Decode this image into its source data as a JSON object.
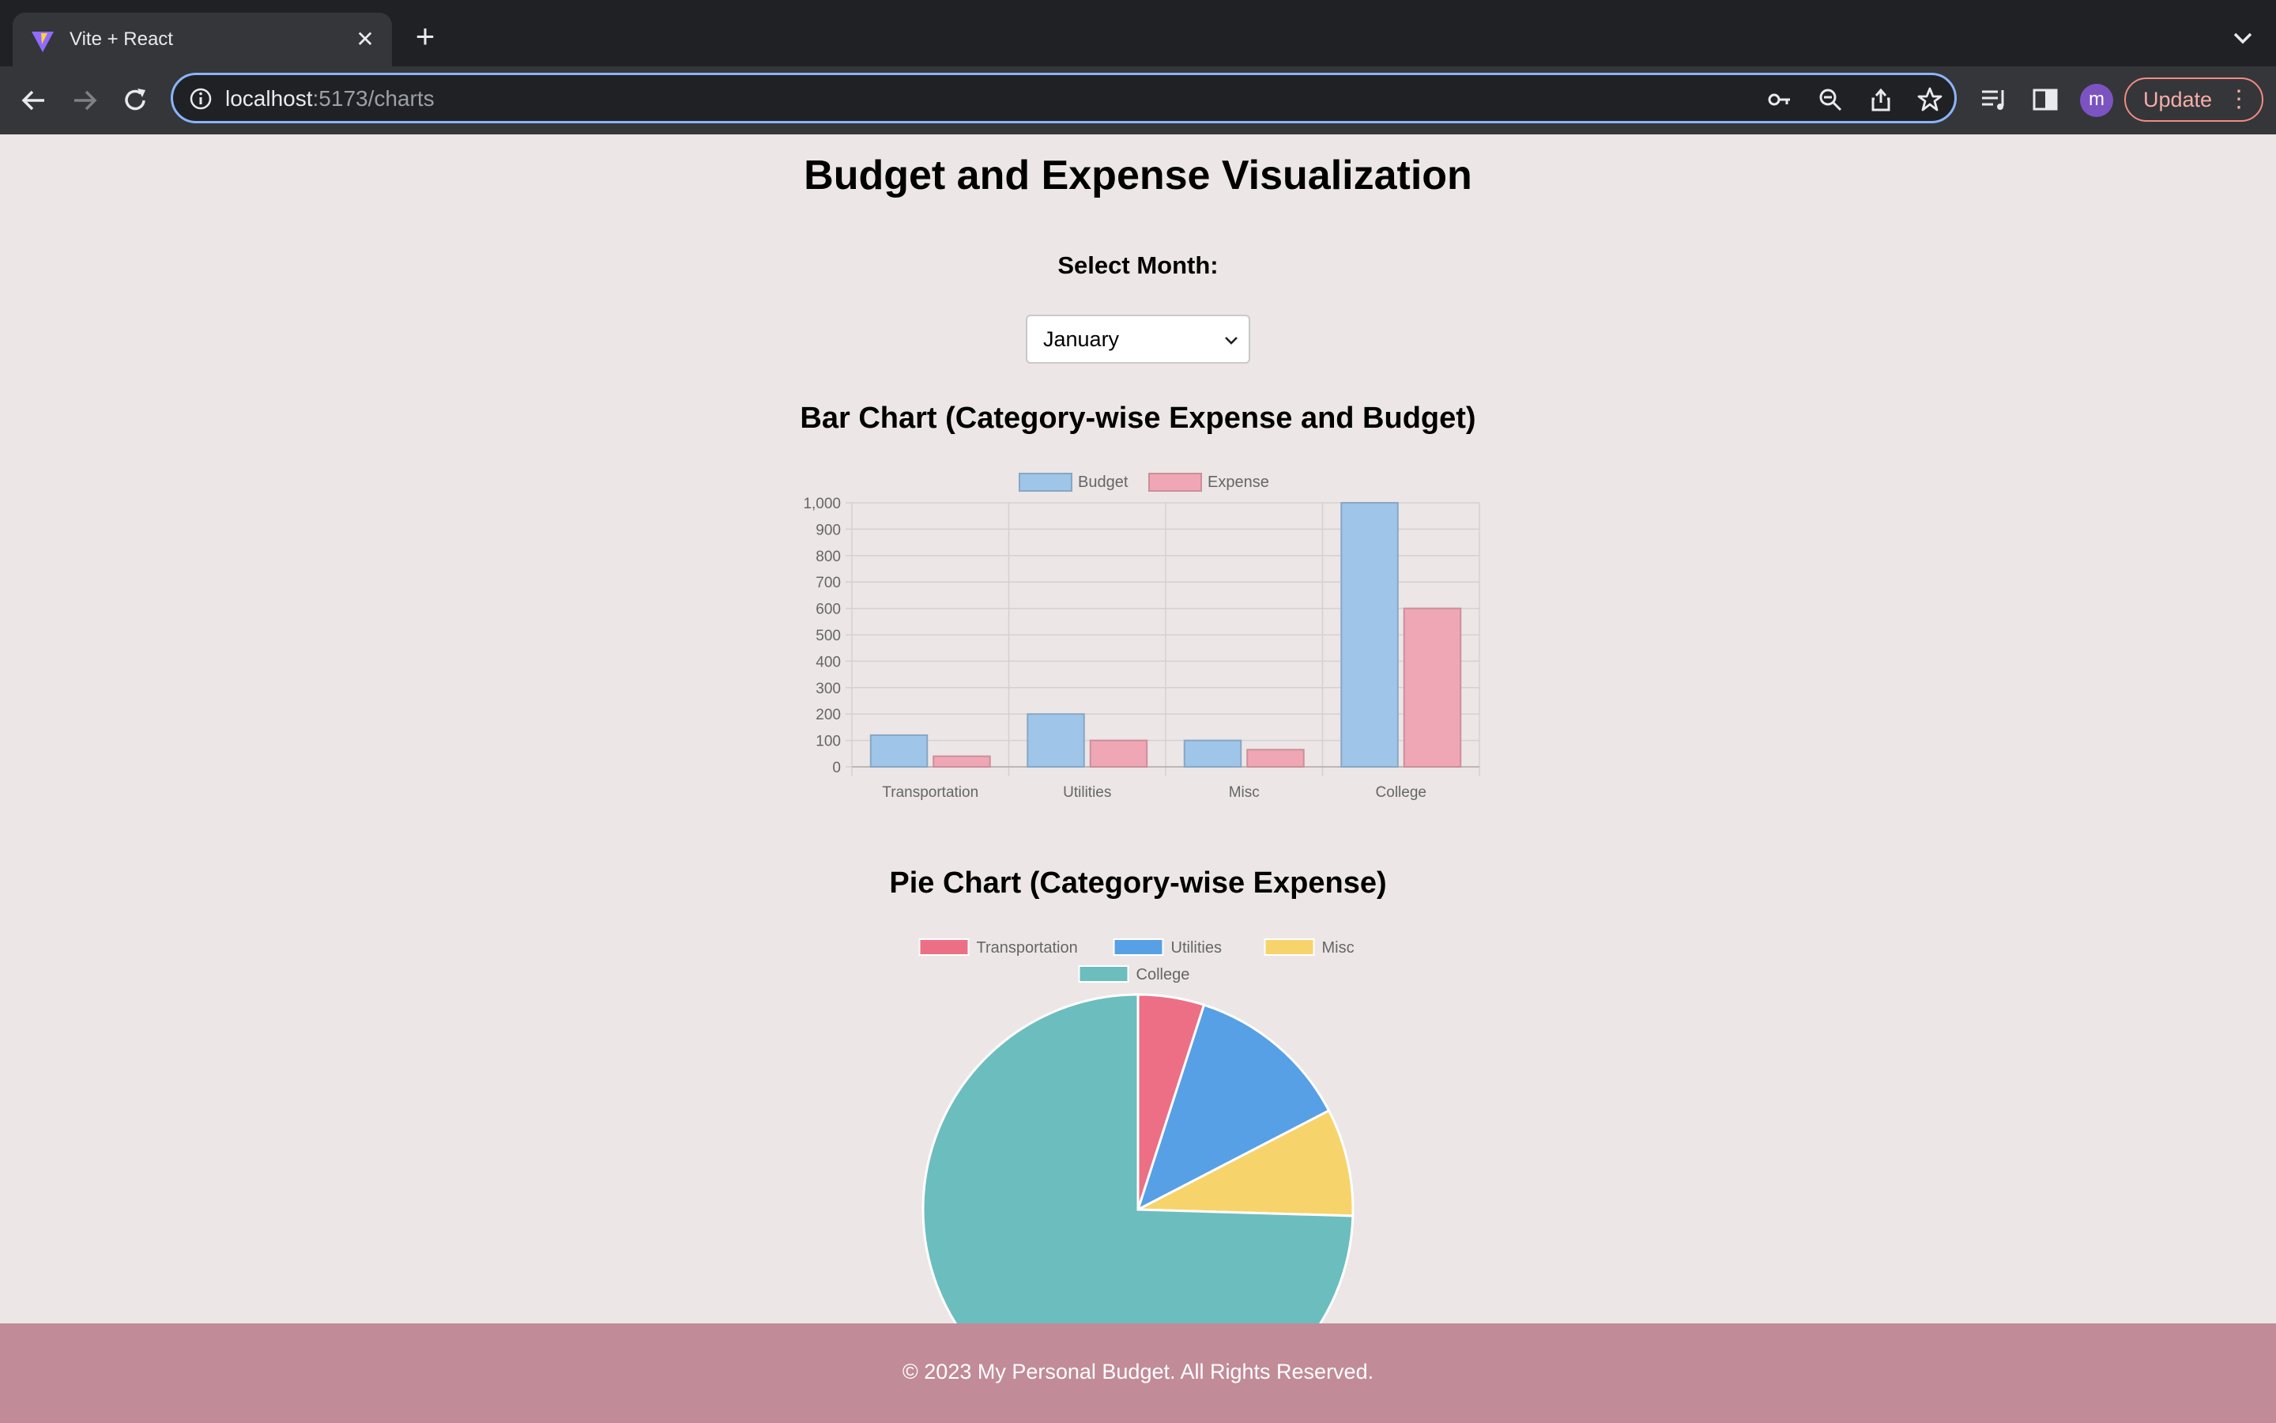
{
  "browser": {
    "tab_title": "Vite + React",
    "url_host": "localhost",
    "url_path": ":5173/charts",
    "update_label": "Update",
    "avatar_letter": "m"
  },
  "page": {
    "title": "Budget and Expense Visualization",
    "select_label": "Select Month:",
    "selected_month": "January",
    "bar_title": "Bar Chart (Category-wise Expense and Budget)",
    "pie_title": "Pie Chart (Category-wise Expense)"
  },
  "footer": {
    "text": "© 2023 My Personal Budget. All Rights Reserved."
  },
  "chart_data": [
    {
      "type": "bar",
      "categories": [
        "Transportation",
        "Utilities",
        "Misc",
        "College"
      ],
      "series": [
        {
          "name": "Budget",
          "values": [
            120,
            200,
            100,
            1000
          ],
          "color": "#9fc5e8"
        },
        {
          "name": "Expense",
          "values": [
            40,
            100,
            65,
            600
          ],
          "color": "#f0a7b5"
        }
      ],
      "ylim": [
        0,
        1000
      ],
      "yticks": [
        "0",
        "100",
        "200",
        "300",
        "400",
        "500",
        "600",
        "700",
        "800",
        "900",
        "1,000"
      ],
      "legend": "top",
      "grid": true
    },
    {
      "type": "pie",
      "labels": [
        "Transportation",
        "Utilities",
        "Misc",
        "College"
      ],
      "values": [
        40,
        100,
        65,
        600
      ],
      "colors": [
        "#ed6f85",
        "#57a0e5",
        "#f7d36b",
        "#6cbdbe"
      ],
      "legend": "top"
    }
  ]
}
